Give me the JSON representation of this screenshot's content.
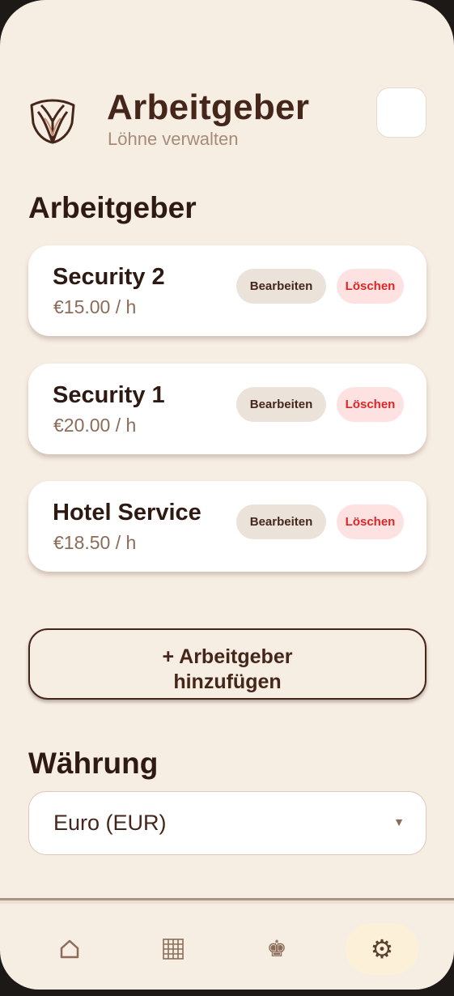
{
  "header": {
    "title": "Arbeitgeber",
    "subtitle": "Löhne verwalten"
  },
  "employers": {
    "section_title": "Arbeitgeber",
    "items": [
      {
        "name": "Security 2",
        "rate": "€15.00 / h",
        "edit_label": "Bearbeiten",
        "delete_label": "Löschen"
      },
      {
        "name": "Security 1",
        "rate": "€20.00 / h",
        "edit_label": "Bearbeiten",
        "delete_label": "Löschen"
      },
      {
        "name": "Hotel Service",
        "rate": "€18.50 / h",
        "edit_label": "Bearbeiten",
        "delete_label": "Löschen"
      }
    ],
    "add_label": "+ Arbeitgeber hinzufügen"
  },
  "currency": {
    "section_title": "Währung",
    "selected": "Euro (EUR)",
    "arrow": "▼"
  },
  "nav": {
    "items": [
      {
        "icon": "home-icon",
        "glyph": "⌂",
        "active": false
      },
      {
        "icon": "calendar-grid-icon",
        "glyph": "",
        "active": false
      },
      {
        "icon": "crown-icon",
        "glyph": "♚",
        "active": false
      },
      {
        "icon": "gear-icon",
        "glyph": "⚙",
        "active": true
      }
    ]
  },
  "colors": {
    "background": "#f6ede3",
    "brand": "#45261a",
    "delete": "#dc2626",
    "active_nav": "#fdf0d9"
  }
}
